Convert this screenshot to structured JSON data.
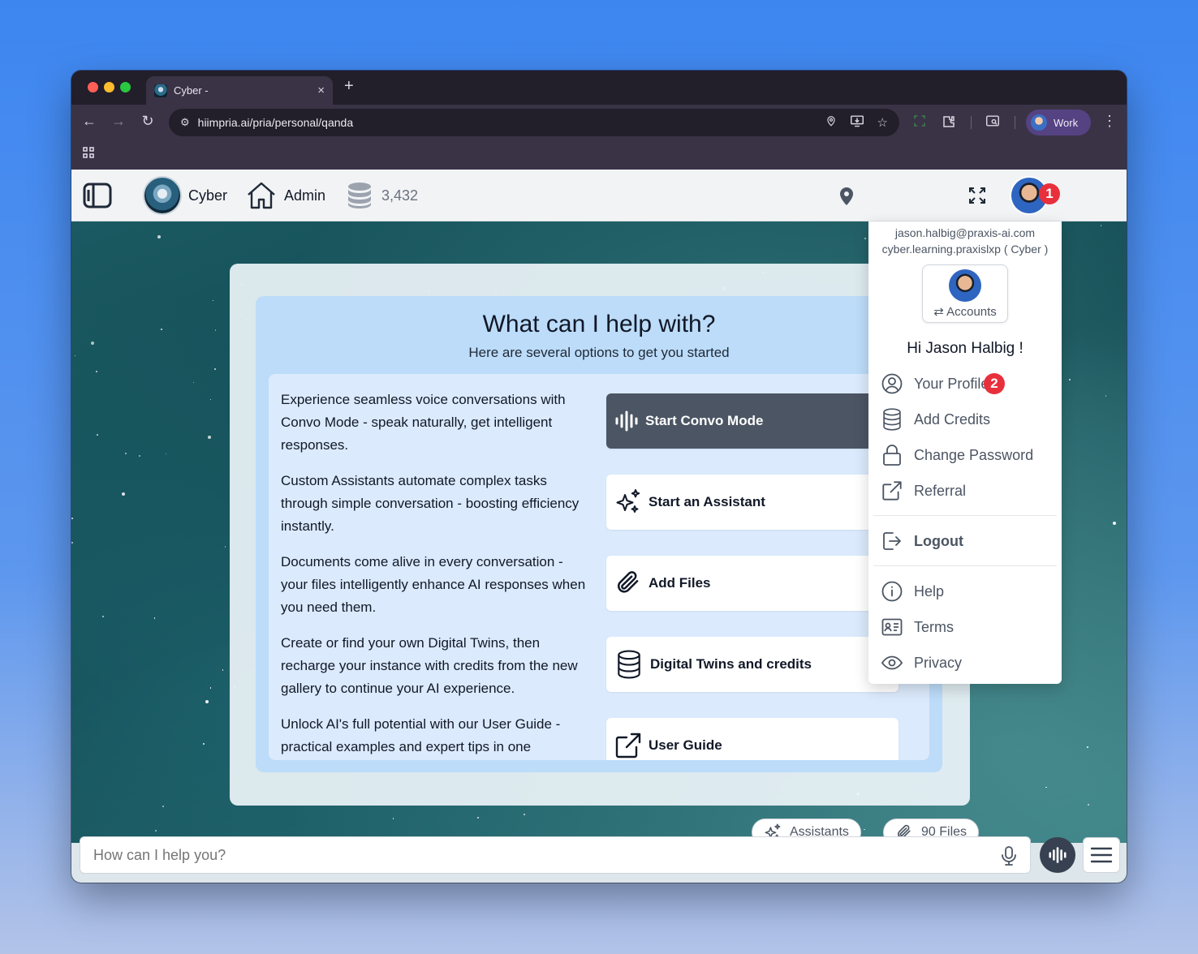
{
  "browser": {
    "tab_title": "Cyber -",
    "new_tab_symbol": "+",
    "tab_close_symbol": "×",
    "url": "hiimpria.ai/pria/personal/qanda",
    "profile_label": "Work"
  },
  "header": {
    "app_name": "Cyber",
    "admin_label": "Admin",
    "credits": "3,432",
    "notification_badge": "1"
  },
  "help": {
    "title": "What can I help with?",
    "subtitle": "Here are several options to get you started",
    "options": [
      {
        "description": "Experience seamless voice conversations with Convo Mode - speak naturally, get intelligent responses.",
        "button": "Start Convo Mode",
        "icon": "waveform-icon"
      },
      {
        "description": "Custom Assistants automate complex tasks through simple conversation - boosting efficiency instantly.",
        "button": "Start an Assistant",
        "icon": "sparkles-icon"
      },
      {
        "description": "Documents come alive in every conversation - your files intelligently enhance AI responses when you need them.",
        "button": "Add Files",
        "icon": "paperclip-icon"
      },
      {
        "description": "Create or find your own Digital Twins, then recharge your instance with credits from the new gallery to continue your AI experience.",
        "button": "Digital Twins and credits",
        "icon": "database-icon"
      },
      {
        "description": "Unlock AI's full potential with our User Guide - practical examples and expert tips in one",
        "button": "User Guide",
        "icon": "external-link-icon"
      }
    ]
  },
  "chat": {
    "assistants_chip": "Assistants",
    "files_chip": "90 Files",
    "input_placeholder": "How can I help you?"
  },
  "dropdown": {
    "email": "jason.halbig@praxis-ai.com",
    "account": "cyber.learning.praxislxp ( Cyber )",
    "accounts_label": "Accounts",
    "greeting": "Hi Jason Halbig !",
    "profile_badge": "2",
    "items": [
      {
        "label": "Your Profile",
        "icon": "user-circle-icon"
      },
      {
        "label": "Add Credits",
        "icon": "database-icon"
      },
      {
        "label": "Change Password",
        "icon": "lock-icon"
      },
      {
        "label": "Referral",
        "icon": "external-link-icon"
      },
      {
        "label": "Logout",
        "icon": "logout-icon"
      },
      {
        "label": "Help",
        "icon": "info-icon"
      },
      {
        "label": "Terms",
        "icon": "id-card-icon"
      },
      {
        "label": "Privacy",
        "icon": "eye-icon"
      }
    ]
  },
  "colors": {
    "badge_red": "#e8303c",
    "dark_button": "#4b5563",
    "help_panel": "#bcdcf9"
  }
}
